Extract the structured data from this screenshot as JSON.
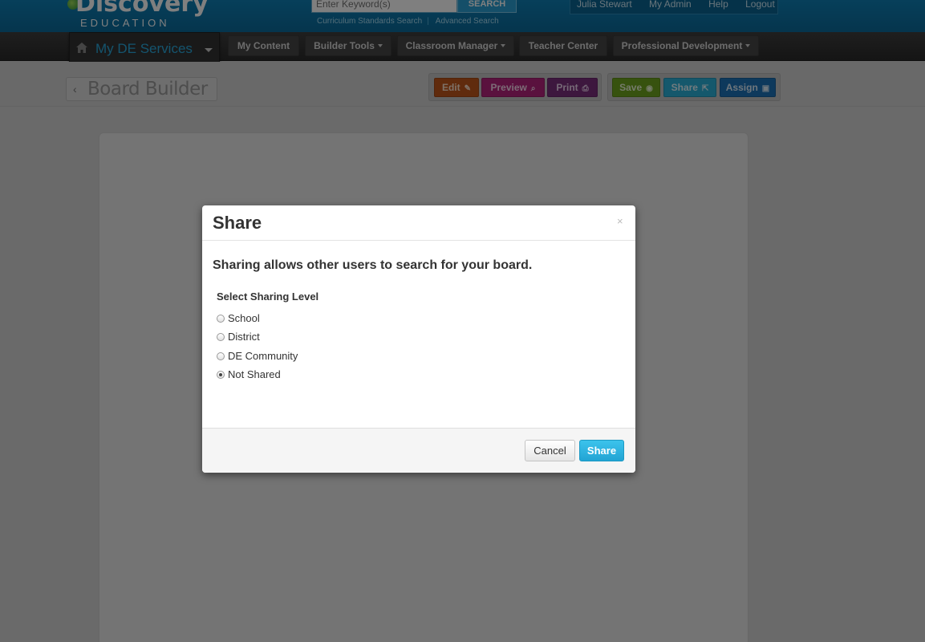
{
  "brand": {
    "name_top": "Discovery",
    "name_bottom": "EDUCATION"
  },
  "search": {
    "placeholder": "Enter Keyword(s)",
    "button": "SEARCH",
    "links": [
      "Curriculum Standards Search",
      "Advanced Search"
    ]
  },
  "user_nav": [
    "Julia Stewart",
    "My Admin",
    "Help",
    "Logout"
  ],
  "main_nav": {
    "services_label": "My DE Services",
    "items": [
      {
        "label": "My Content",
        "has_menu": false
      },
      {
        "label": "Builder Tools",
        "has_menu": true
      },
      {
        "label": "Classroom Manager",
        "has_menu": true
      },
      {
        "label": "Teacher Center",
        "has_menu": false
      },
      {
        "label": "Professional Development",
        "has_menu": true
      }
    ]
  },
  "board_builder": {
    "title": "Board Builder"
  },
  "toolbar": {
    "edit": "Edit",
    "preview": "Preview",
    "print": "Print",
    "save": "Save",
    "share": "Share",
    "assign": "Assign"
  },
  "colors": {
    "header": "#0e7fb5",
    "edit": "#c1561a",
    "preview": "#b4237c",
    "print": "#7b2e7d",
    "save": "#6fa51e",
    "share": "#2ab0d8",
    "assign": "#1d72b8",
    "primary_button": "#22a4d4"
  },
  "modal": {
    "title": "Share",
    "close": "×",
    "lead": "Sharing allows other users to search for your board.",
    "level_label": "Select Sharing Level",
    "options": [
      {
        "label": "School",
        "selected": false
      },
      {
        "label": "District",
        "selected": false
      },
      {
        "label": "DE Community",
        "selected": false
      },
      {
        "label": "Not Shared",
        "selected": true
      }
    ],
    "cancel": "Cancel",
    "confirm": "Share"
  }
}
